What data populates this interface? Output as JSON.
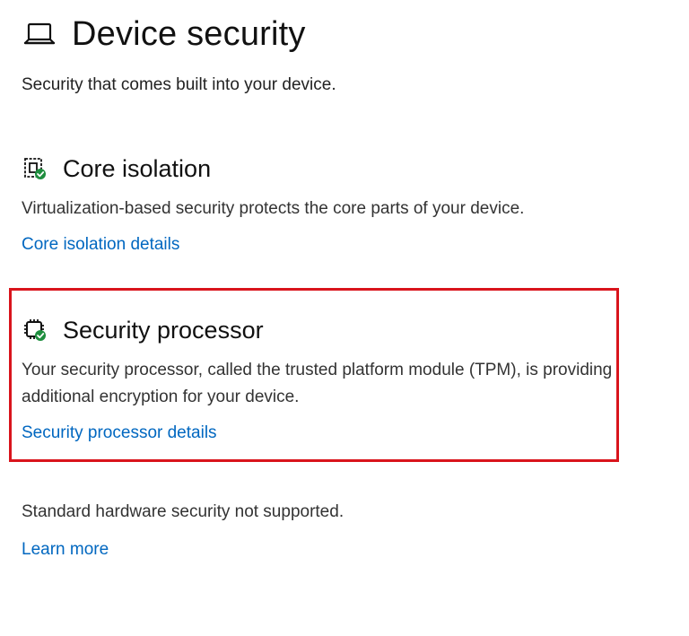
{
  "header": {
    "icon": "laptop-icon",
    "title": "Device security"
  },
  "subtitle": "Security that comes built into your device.",
  "sections": [
    {
      "icon": "core-isolation-icon",
      "title": "Core isolation",
      "description": "Virtualization-based security protects the core parts of your device.",
      "link": "Core isolation details"
    },
    {
      "icon": "security-processor-icon",
      "title": "Security processor",
      "description": "Your security processor, called the trusted platform module (TPM), is providing additional encryption for your device.",
      "link": "Security processor details",
      "highlighted": true
    }
  ],
  "standard_hardware": {
    "text": "Standard hardware security not supported.",
    "link": "Learn more"
  },
  "colors": {
    "link": "#0067c0",
    "highlight_border": "#d9141c",
    "status_ok": "#1e8e3e"
  }
}
